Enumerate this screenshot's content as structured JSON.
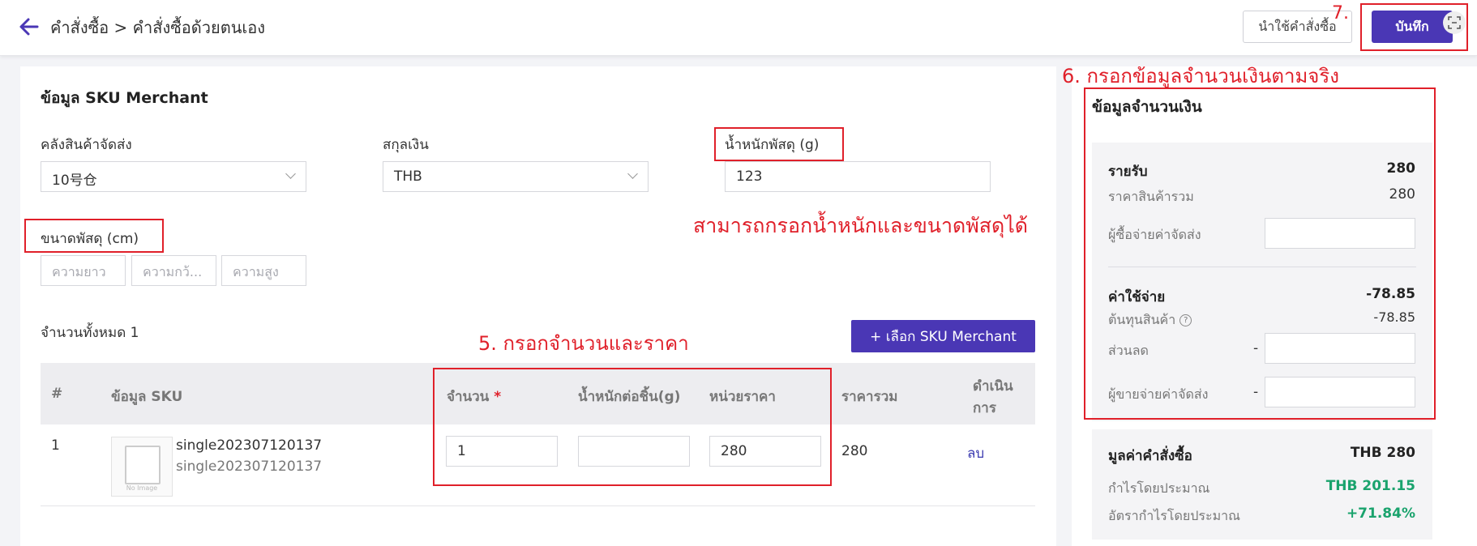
{
  "header": {
    "breadcrumb": "คำสั่งซื้อ > คำสั่งซื้อด้วยตนเอง",
    "use_order_button": "นำใช้คำสั่งซื้อ",
    "save_button": "บันทึก"
  },
  "sku_section": {
    "title": "ข้อมูล SKU Merchant",
    "warehouse_label": "คลังสินค้าจัดส่ง",
    "warehouse_value": "10号仓",
    "currency_label": "สกุลเงิน",
    "currency_value": "THB",
    "weight_label": "น้ำหนักพัสดุ (g)",
    "weight_value": "123",
    "size_label": "ขนาดพัสดุ (cm)",
    "length_placeholder": "ความยาว",
    "width_placeholder": "ความกว้...",
    "height_placeholder": "ความสูง",
    "total_count": "จำนวนทั้งหมด 1",
    "select_button": "+ เลือก SKU Merchant"
  },
  "table": {
    "headers": {
      "index": "#",
      "sku_info": "ข้อมูล SKU",
      "quantity": "จำนวน",
      "required_mark": "*",
      "unit_weight": "น้ำหนักต่อชิ้น(g)",
      "unit_price": "หน่วยราคา",
      "total_price": "ราคารวม",
      "action_line1": "ดำเนิน",
      "action_line2": "การ"
    },
    "rows": [
      {
        "index": "1",
        "name": "single202307120137",
        "code": "single202307120137",
        "no_image_caption": "No Image",
        "quantity": "1",
        "unit_weight": "",
        "unit_price": "280",
        "total": "280",
        "delete_label": "ลบ"
      }
    ]
  },
  "amount_section": {
    "title": "ข้อมูลจำนวนเงิน",
    "income_label": "รายรับ",
    "income_value": "280",
    "product_total_label": "ราคาสินค้ารวม",
    "product_total_value": "280",
    "buyer_shipping_label": "ผู้ซื้อจ่ายค่าจัดส่ง",
    "expense_label": "ค่าใช้จ่าย",
    "expense_value": "-78.85",
    "cost_label": "ต้นทุนสินค้า",
    "cost_help": "?",
    "cost_value": "-78.85",
    "discount_label": "ส่วนลด",
    "discount_prefix": "-",
    "seller_shipping_label": "ผู้ขายจ่ายค่าจัดส่ง",
    "seller_shipping_prefix": "-",
    "order_value_label": "มูลค่าคำสั่งซื้อ",
    "order_value": "THB 280",
    "est_profit_label": "กำไรโดยประมาณ",
    "est_profit_value": "THB 201.15",
    "profit_rate_label": "อัตรากำไรโดยประมาณ",
    "profit_rate_value": "+71.84%"
  },
  "annotations": {
    "step7": "7.",
    "step6": "6. กรอกข้อมูลจำนวนเงินตามจริง",
    "step5": "5. กรอกจำนวนและราคา",
    "weight_note": "สามารถกรอกน้ำหนักและขนาดพัสดุได้"
  },
  "colors": {
    "primary": "#4a37b5",
    "annotation_red": "#e0202a",
    "profit_green": "#1aa36d"
  }
}
